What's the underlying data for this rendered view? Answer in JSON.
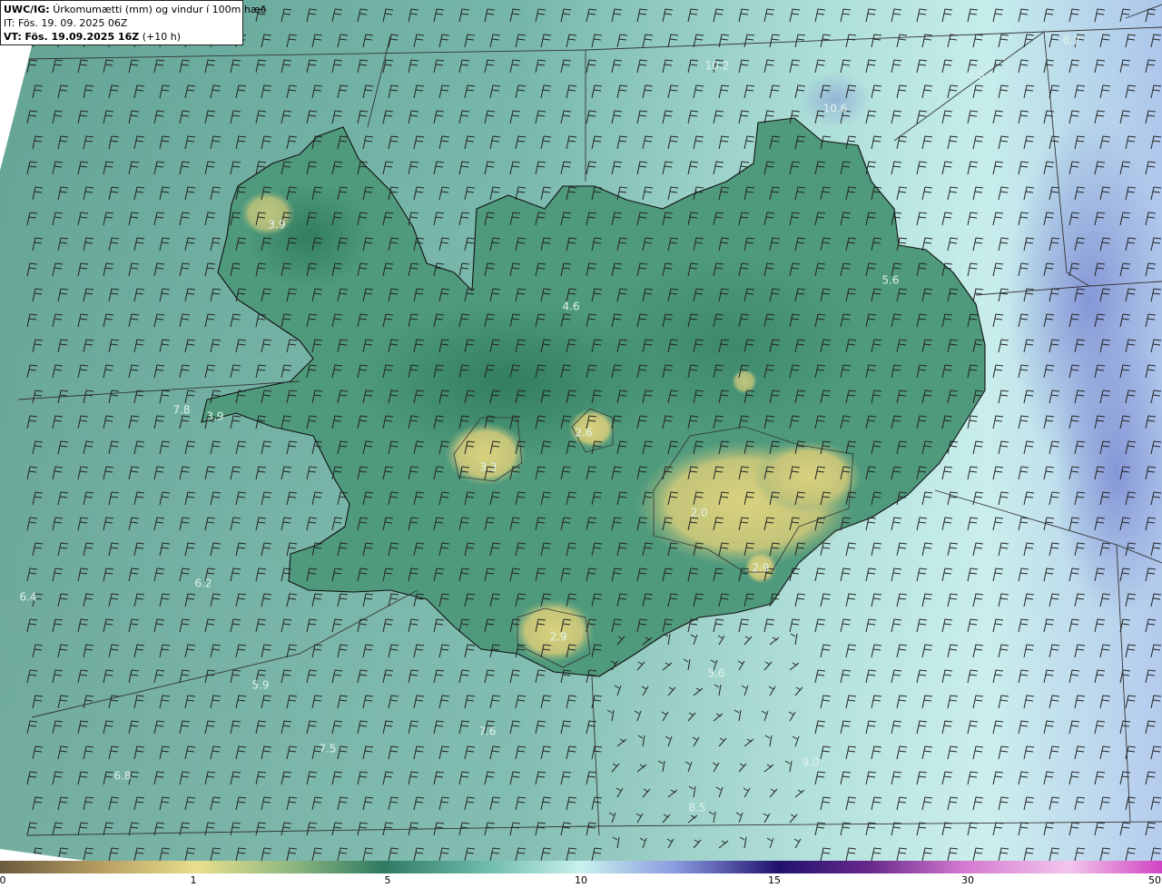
{
  "header": {
    "model": "UWC/IG:",
    "title": "Úrkomumætti (mm) og vindur í 100m hæð",
    "init_time": "IT: Fös. 19. 09. 2025 06Z",
    "valid_prefix": "VT:",
    "valid_time": "Fös. 19.09.2025 16Z",
    "valid_offset": "(+10 h)"
  },
  "colors": {
    "background_map": "#5ea598",
    "highland": "#c9c77a",
    "sea_light": "#b8e6e2",
    "sea_blue": "#8a9fd8",
    "coast": "#111111"
  },
  "map_labels": [
    {
      "text": "3.9"
    },
    {
      "text": "4.6"
    },
    {
      "text": "5.6"
    },
    {
      "text": "3.9"
    },
    {
      "text": "7.8"
    },
    {
      "text": "3.3"
    },
    {
      "text": "2.6"
    },
    {
      "text": "2.0"
    },
    {
      "text": "2.9"
    },
    {
      "text": "2.9"
    },
    {
      "text": "6.4"
    },
    {
      "text": "6.2"
    },
    {
      "text": "5.9"
    },
    {
      "text": "5.6"
    },
    {
      "text": "7.6"
    },
    {
      "text": "7.5"
    },
    {
      "text": "6.8"
    },
    {
      "text": "10.2"
    },
    {
      "text": "10.6"
    },
    {
      "text": "8.5"
    },
    {
      "text": "8.2"
    },
    {
      "text": "9.0"
    },
    {
      "text": "8.5"
    }
  ],
  "colorbar": {
    "ticks": [
      "0",
      "1",
      "5",
      "10",
      "15",
      "30",
      "50"
    ]
  }
}
